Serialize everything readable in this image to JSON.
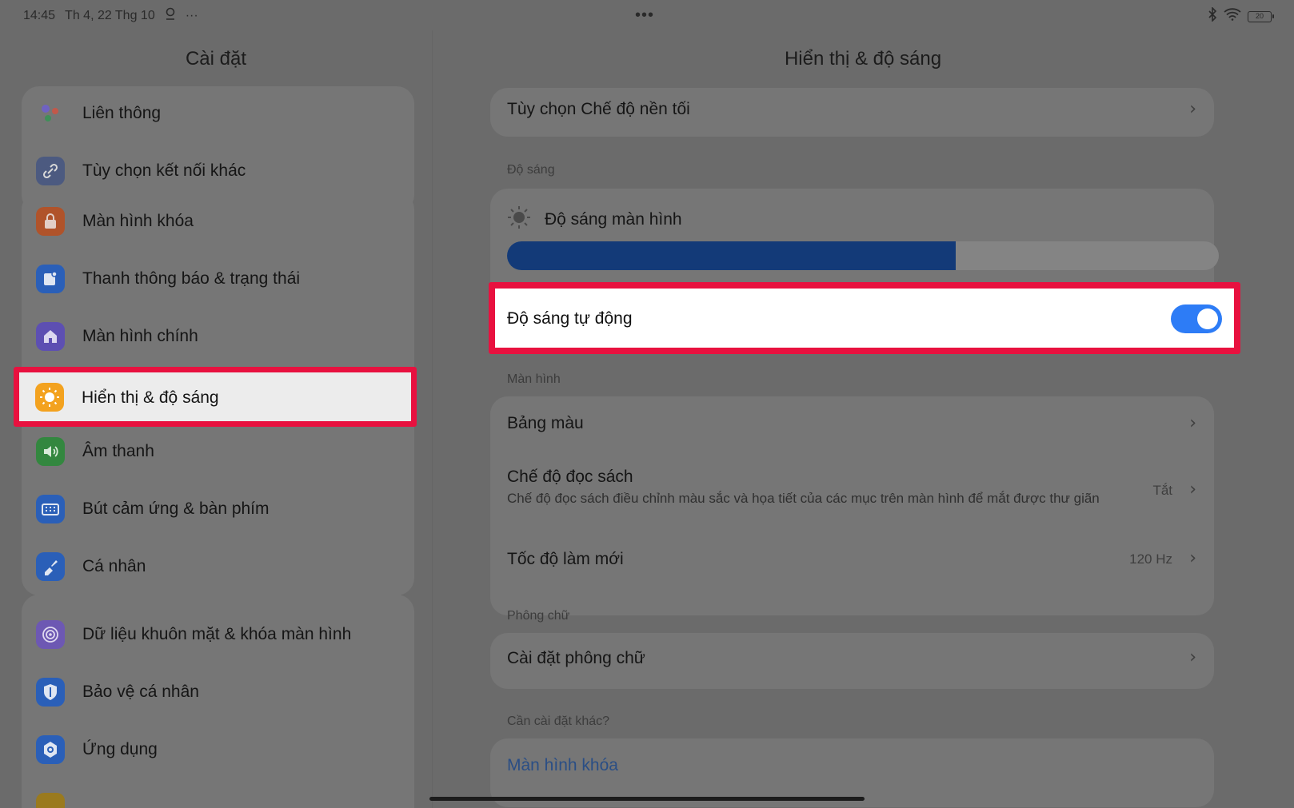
{
  "status_bar": {
    "time": "14:45",
    "date": "Th 4, 22 Thg 10",
    "dots": "•••",
    "battery": "20"
  },
  "left": {
    "title": "Cài đặt",
    "items": [
      {
        "label": "Liên thông",
        "icon": "connect-dots-icon",
        "color": "#7b6fc9"
      },
      {
        "label": "Tùy chọn kết nối khác",
        "icon": "link-icon",
        "color": "#5d6f9b"
      },
      {
        "label": "Màn hình khóa",
        "icon": "lock-icon",
        "color": "#c85a2c"
      },
      {
        "label": "Thanh thông báo & trạng thái",
        "icon": "notification-icon",
        "color": "#2e6ad1"
      },
      {
        "label": "Màn hình chính",
        "icon": "home-icon",
        "color": "#6a5acd"
      },
      {
        "label": "Hiển thị & độ sáng",
        "icon": "sun-icon",
        "color": "#f3a21f"
      },
      {
        "label": "Âm thanh",
        "icon": "speaker-icon",
        "color": "#3a9a47"
      },
      {
        "label": "Bút cảm ứng & bàn phím",
        "icon": "keyboard-icon",
        "color": "#2e6ad1"
      },
      {
        "label": "Cá nhân",
        "icon": "brush-icon",
        "color": "#2e6ad1"
      },
      {
        "label": "Dữ liệu khuôn mặt & khóa màn hình",
        "icon": "face-id-icon",
        "color": "#7d64c4"
      },
      {
        "label": "Bảo vệ cá nhân",
        "icon": "shield-icon",
        "color": "#2e6ad1"
      },
      {
        "label": "Ứng dụng",
        "icon": "gear-icon",
        "color": "#2e6ad1"
      }
    ]
  },
  "right": {
    "title": "Hiển thị & độ sáng",
    "dark_mode_option": "Tùy chọn Chế độ nền tối",
    "brightness_section": "Độ sáng",
    "screen_brightness": "Độ sáng màn hình",
    "brightness_level": 0.63,
    "auto_brightness": "Độ sáng tự động",
    "auto_brightness_on": true,
    "screen_section": "Màn hình",
    "color_palette": "Bảng màu",
    "reading_mode": "Chế độ đọc sách",
    "reading_mode_desc": "Chế độ đọc sách điều chỉnh màu sắc và họa tiết của các mục trên màn hình để mắt được thư giãn",
    "reading_mode_value": "Tắt",
    "refresh_rate": "Tốc độ làm mới",
    "refresh_rate_value": "120 Hz",
    "font_section": "Phông chữ",
    "font_settings": "Cài đặt phông chữ",
    "other_section": "Cần cài đặt khác?",
    "lock_screen_link": "Màn hình khóa"
  },
  "colors": {
    "highlight_border": "#e8113f",
    "toggle_on": "#2d7cf6",
    "slider_fill": "#133a78"
  }
}
